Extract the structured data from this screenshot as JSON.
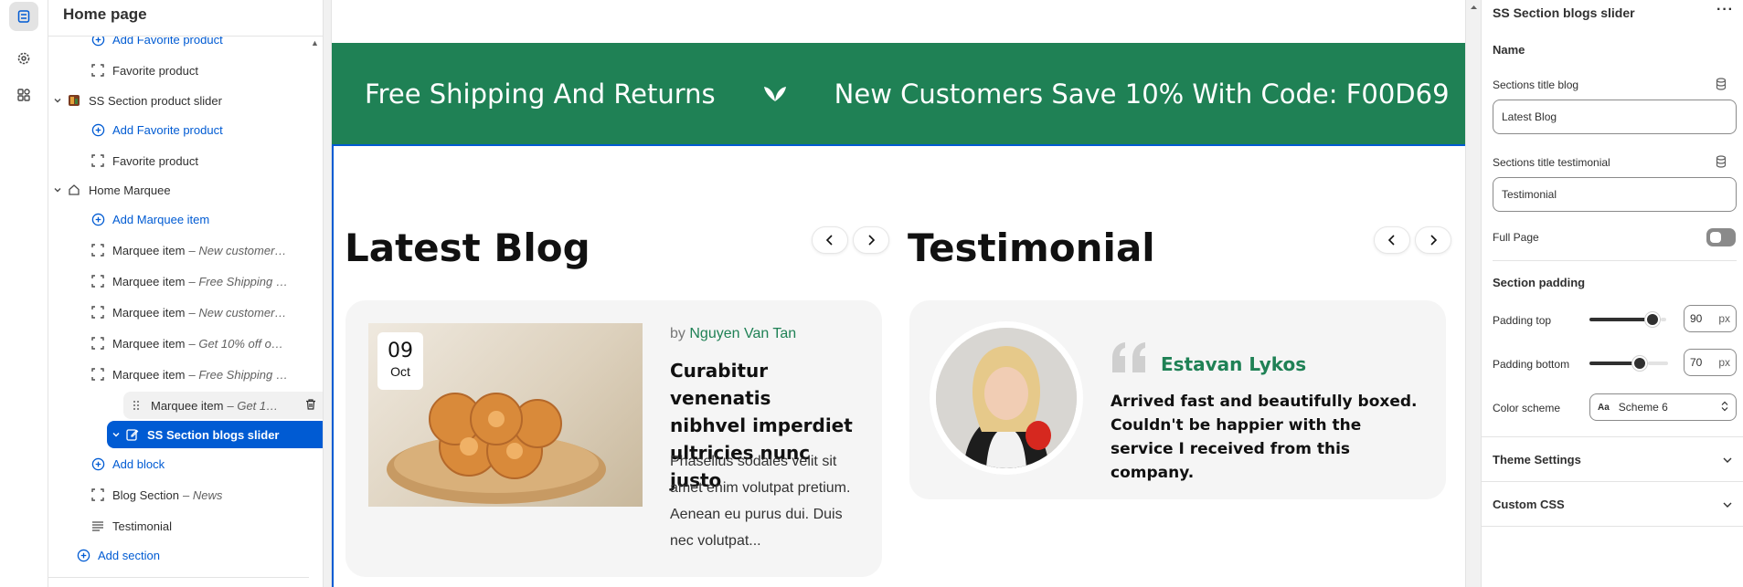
{
  "tree": {
    "title": "Home page",
    "rows": [
      {
        "label": "Add Favorite product",
        "sub": ""
      },
      {
        "label": "Favorite product",
        "sub": ""
      },
      {
        "label": "SS Section product slider",
        "sub": ""
      },
      {
        "label": "Add Favorite product",
        "sub": ""
      },
      {
        "label": "Favorite product",
        "sub": ""
      },
      {
        "label": "Home Marquee",
        "sub": ""
      },
      {
        "label": "Add Marquee item",
        "sub": ""
      },
      {
        "label": "Marquee item",
        "sub": "– New customers ..."
      },
      {
        "label": "Marquee item",
        "sub": "– Free Shipping a..."
      },
      {
        "label": "Marquee item",
        "sub": "– New customers ..."
      },
      {
        "label": "Marquee item",
        "sub": "– Get 10% off on s..."
      },
      {
        "label": "Marquee item",
        "sub": "– Free Shipping a..."
      },
      {
        "label": "Marquee item",
        "sub": "– Get 10..."
      },
      {
        "label": "SS Section blogs slider",
        "sub": ""
      },
      {
        "label": "Add block",
        "sub": ""
      },
      {
        "label": "Blog Section",
        "sub": "– News"
      },
      {
        "label": "Testimonial",
        "sub": ""
      },
      {
        "label": "Add section",
        "sub": ""
      }
    ]
  },
  "preview": {
    "marquee": [
      "Free Shipping And Returns",
      "New Customers Save 10% With Code: F00D69"
    ],
    "blog": {
      "section_title": "Latest Blog",
      "date_day": "09",
      "date_month": "Oct",
      "by": "by",
      "author": "Nguyen Van Tan",
      "title": "Curabitur venenatis nibhvel imperdiet ultricies nunc justo",
      "excerpt": "Phasellus sodales velit sit amet enim volutpat pretium. Aenean eu purus dui. Duis nec volutpat..."
    },
    "testimonial": {
      "section_title": "Testimonial",
      "name": "Estavan Lykos",
      "text": "Arrived fast and beautifully boxed. Couldn't be happier with the service I received from this company."
    },
    "colors": {
      "green": "#1f8155",
      "selection": "#005bd3"
    }
  },
  "settings": {
    "title": "SS Section blogs slider",
    "name_heading": "Name",
    "blog_title_label": "Sections title blog",
    "blog_title_value": "Latest Blog",
    "testimonial_title_label": "Sections title testimonial",
    "testimonial_title_value": "Testimonial",
    "full_page_label": "Full Page",
    "full_page_on": false,
    "padding_heading": "Section padding",
    "padding_top_label": "Padding top",
    "padding_top_value": "90",
    "padding_bottom_label": "Padding bottom",
    "padding_bottom_value": "70",
    "unit": "px",
    "color_scheme_label": "Color scheme",
    "color_scheme_value": "Scheme 6",
    "theme_settings": "Theme Settings",
    "custom_css": "Custom CSS"
  }
}
